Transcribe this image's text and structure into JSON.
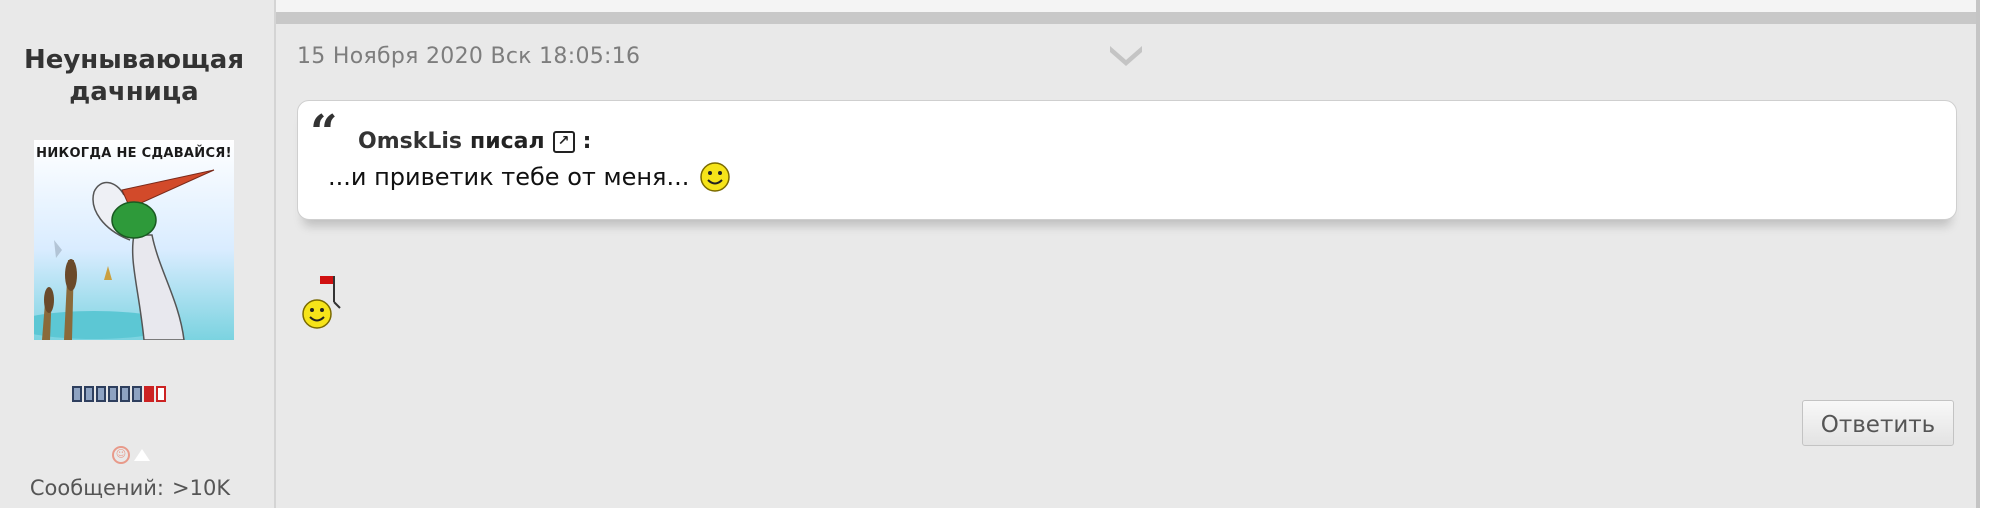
{
  "post": {
    "author": "Неунывающая дачница",
    "avatar_caption": "НИКОГДА НЕ СДАВАЙСЯ!",
    "rank_icons": "rank-bars",
    "messages_label": "Сообщений:",
    "messages_value": ">10K",
    "date": "15 Ноября 2020 Вск 18:05:16",
    "quote": {
      "author": "OmskLis",
      "wrote": "писал",
      "colon": ":",
      "text": "...и приветик тебе от меня..."
    },
    "reply_label": "Ответить"
  },
  "icons": {
    "collapse": "chevron-down-icon",
    "quote_link": "external-link-icon",
    "smiley": "smiley-icon",
    "music_smiley": "smiley-flag-icon"
  }
}
